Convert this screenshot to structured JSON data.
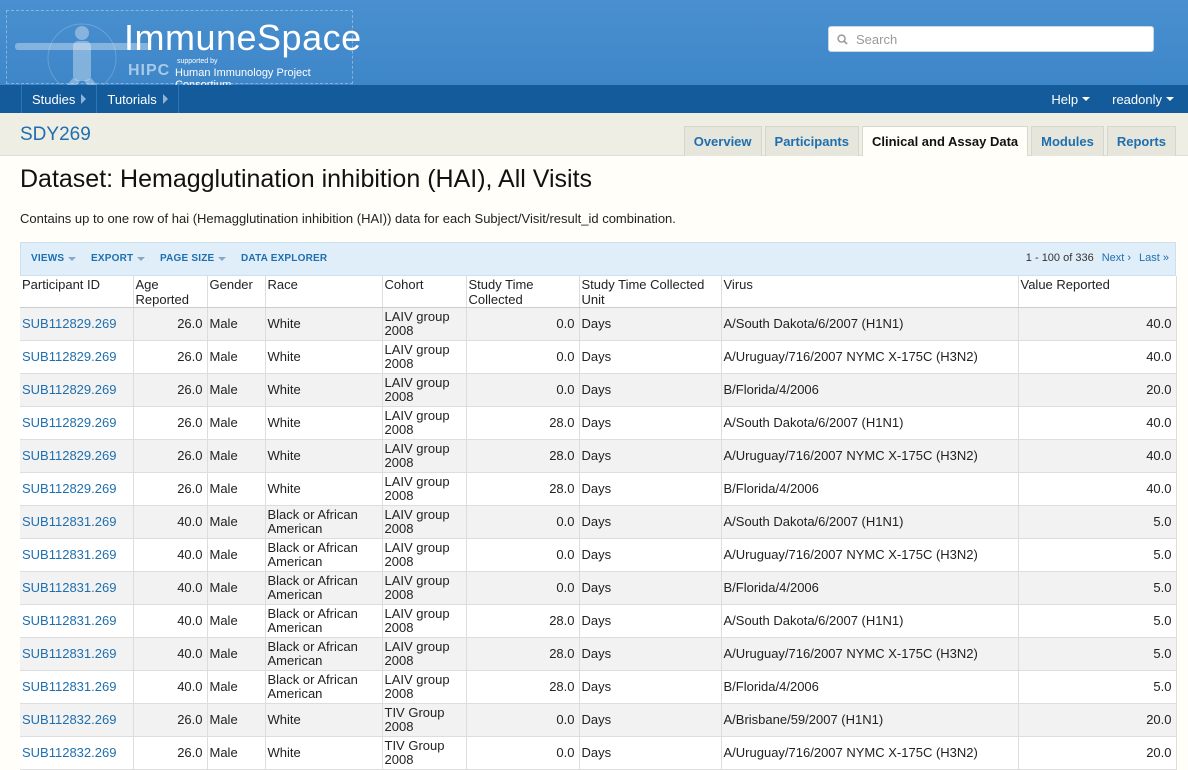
{
  "header": {
    "brand": "ImmuneSpace",
    "supported_by": "supported by",
    "hipc": "HIPC",
    "consortium": "Human Immunology Project Consortium",
    "search_placeholder": "Search"
  },
  "nav": {
    "items": [
      {
        "label": "Studies"
      },
      {
        "label": "Tutorials"
      }
    ],
    "help": "Help",
    "user": "readonly"
  },
  "study": {
    "id": "SDY269",
    "tabs": [
      {
        "label": "Overview"
      },
      {
        "label": "Participants"
      },
      {
        "label": "Clinical and Assay Data"
      },
      {
        "label": "Modules"
      },
      {
        "label": "Reports"
      }
    ],
    "active_tab": "Clinical and Assay Data"
  },
  "dataset": {
    "title": "Dataset: Hemagglutination inhibition (HAI), All Visits",
    "description": "Contains up to one row of hai (Hemagglutination inhibition (HAI)) data for each Subject/Visit/result_id combination."
  },
  "grid": {
    "buttons": [
      "VIEWS",
      "EXPORT",
      "PAGE SIZE",
      "DATA EXPLORER"
    ],
    "paging_text": "1 - 100 of 336",
    "next": "Next ›",
    "last": "Last »",
    "columns": [
      "Participant ID",
      "Age Reported",
      "Gender",
      "Race",
      "Cohort",
      "Study Time Collected",
      "Study Time Collected Unit",
      "Virus",
      "Value Reported"
    ],
    "rows": [
      [
        "SUB112829.269",
        "26.0",
        "Male",
        "White",
        "LAIV group 2008",
        "0.0",
        "Days",
        "A/South Dakota/6/2007 (H1N1)",
        "40.0"
      ],
      [
        "SUB112829.269",
        "26.0",
        "Male",
        "White",
        "LAIV group 2008",
        "0.0",
        "Days",
        "A/Uruguay/716/2007 NYMC X-175C (H3N2)",
        "40.0"
      ],
      [
        "SUB112829.269",
        "26.0",
        "Male",
        "White",
        "LAIV group 2008",
        "0.0",
        "Days",
        "B/Florida/4/2006",
        "20.0"
      ],
      [
        "SUB112829.269",
        "26.0",
        "Male",
        "White",
        "LAIV group 2008",
        "28.0",
        "Days",
        "A/South Dakota/6/2007 (H1N1)",
        "40.0"
      ],
      [
        "SUB112829.269",
        "26.0",
        "Male",
        "White",
        "LAIV group 2008",
        "28.0",
        "Days",
        "A/Uruguay/716/2007 NYMC X-175C (H3N2)",
        "40.0"
      ],
      [
        "SUB112829.269",
        "26.0",
        "Male",
        "White",
        "LAIV group 2008",
        "28.0",
        "Days",
        "B/Florida/4/2006",
        "40.0"
      ],
      [
        "SUB112831.269",
        "40.0",
        "Male",
        "Black or African American",
        "LAIV group 2008",
        "0.0",
        "Days",
        "A/South Dakota/6/2007 (H1N1)",
        "5.0"
      ],
      [
        "SUB112831.269",
        "40.0",
        "Male",
        "Black or African American",
        "LAIV group 2008",
        "0.0",
        "Days",
        "A/Uruguay/716/2007 NYMC X-175C (H3N2)",
        "5.0"
      ],
      [
        "SUB112831.269",
        "40.0",
        "Male",
        "Black or African American",
        "LAIV group 2008",
        "0.0",
        "Days",
        "B/Florida/4/2006",
        "5.0"
      ],
      [
        "SUB112831.269",
        "40.0",
        "Male",
        "Black or African American",
        "LAIV group 2008",
        "28.0",
        "Days",
        "A/South Dakota/6/2007 (H1N1)",
        "5.0"
      ],
      [
        "SUB112831.269",
        "40.0",
        "Male",
        "Black or African American",
        "LAIV group 2008",
        "28.0",
        "Days",
        "A/Uruguay/716/2007 NYMC X-175C (H3N2)",
        "5.0"
      ],
      [
        "SUB112831.269",
        "40.0",
        "Male",
        "Black or African American",
        "LAIV group 2008",
        "28.0",
        "Days",
        "B/Florida/4/2006",
        "5.0"
      ],
      [
        "SUB112832.269",
        "26.0",
        "Male",
        "White",
        "TIV Group 2008",
        "0.0",
        "Days",
        "A/Brisbane/59/2007 (H1N1)",
        "20.0"
      ],
      [
        "SUB112832.269",
        "26.0",
        "Male",
        "White",
        "TIV Group 2008",
        "0.0",
        "Days",
        "A/Uruguay/716/2007 NYMC X-175C (H3N2)",
        "20.0"
      ]
    ]
  }
}
